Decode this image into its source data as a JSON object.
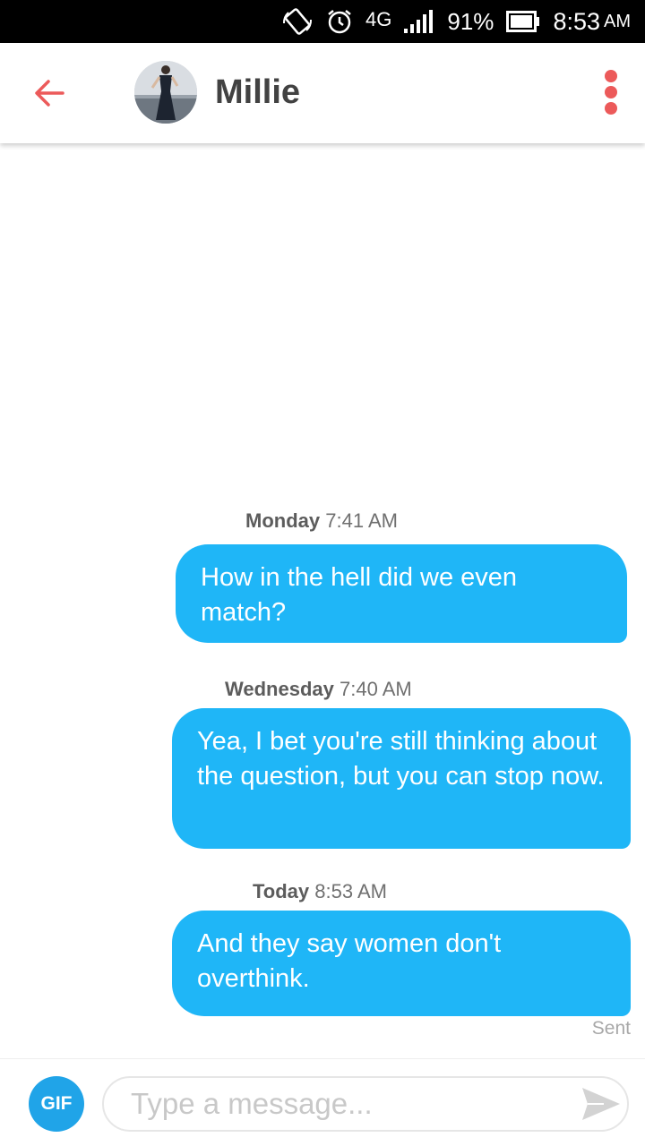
{
  "status_bar": {
    "network": "4G",
    "battery": "91%",
    "time": "8:53",
    "ampm": "AM",
    "icons": [
      "rotate-icon",
      "alarm-icon",
      "network-4g-icon",
      "signal-icon",
      "battery-icon"
    ]
  },
  "header": {
    "contact_name": "Millie",
    "icons": [
      "back-arrow-icon",
      "avatar",
      "overflow-menu-icon"
    ],
    "accent_color": "#ec5a5a"
  },
  "messages": [
    {
      "day": "Monday",
      "time": "7:41 AM",
      "text": "How in the hell did we even match?"
    },
    {
      "day": "Wednesday",
      "time": "7:40 AM",
      "text": "Yea, I bet you're still thinking about the question, but you can stop now."
    },
    {
      "day": "Today",
      "time": "8:53 AM",
      "text": "And they say women don't overthink."
    }
  ],
  "sent_status": "Sent",
  "composer": {
    "gif_label": "GIF",
    "placeholder": "Type a message...",
    "value": "",
    "icons": [
      "send-icon"
    ]
  },
  "colors": {
    "bubble": "#1fb6f7",
    "gif_button": "#20a4e8",
    "status_bar": "#000000"
  }
}
